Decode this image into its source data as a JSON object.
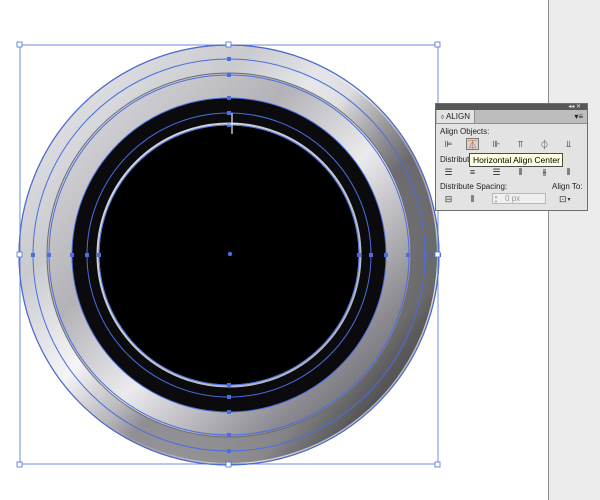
{
  "align_panel": {
    "tab_label": "ALIGN",
    "tab_caret": "◊",
    "collapse_glyph": "◂◂",
    "close_glyph": "✕",
    "menu_glyph": "▾≡",
    "align_objects_label": "Align Objects:",
    "distribute_objects_label": "Distribute",
    "distribute_spacing_label": "Distribute Spacing:",
    "align_to_label": "Align To:",
    "spacing_value": "0 px",
    "spin_up": "▲",
    "spin_down": "▼",
    "tooltip": "Horizontal Align Center",
    "align_object_buttons": [
      {
        "icon": "horizontal-align-left-icon",
        "glyph": "⊫",
        "pressed": false
      },
      {
        "icon": "horizontal-align-center-icon",
        "glyph": "⏄",
        "pressed": true
      },
      {
        "icon": "horizontal-align-right-icon",
        "glyph": "⊪",
        "pressed": false
      },
      {
        "icon": "vertical-align-top-icon",
        "glyph": "⫪",
        "pressed": false
      },
      {
        "icon": "vertical-align-center-icon",
        "glyph": "⏀",
        "pressed": false
      },
      {
        "icon": "vertical-align-bottom-icon",
        "glyph": "⫫",
        "pressed": false
      }
    ],
    "distribute_object_buttons": [
      {
        "icon": "vertical-distribute-top-icon",
        "glyph": "☰"
      },
      {
        "icon": "vertical-distribute-center-icon",
        "glyph": "≡"
      },
      {
        "icon": "vertical-distribute-bottom-icon",
        "glyph": "☰"
      },
      {
        "icon": "horizontal-distribute-left-icon",
        "glyph": "⫴"
      },
      {
        "icon": "horizontal-distribute-center-icon",
        "glyph": "⫵"
      },
      {
        "icon": "horizontal-distribute-right-icon",
        "glyph": "⫴"
      }
    ],
    "distribute_spacing_buttons": [
      {
        "icon": "vertical-distribute-space-icon",
        "glyph": "⊟"
      },
      {
        "icon": "horizontal-distribute-space-icon",
        "glyph": "⫴"
      }
    ],
    "align_to_icon": "align-to-selection-icon",
    "align_to_glyph": "⊡",
    "align_to_caret": "▾"
  },
  "colors": {
    "selection": "#4a6ee0",
    "panel_bg": "#e3e3e3",
    "tooltip_bg": "#ffffe1",
    "canvas_bg": "#ffffff",
    "gutter_bg": "#ececec"
  }
}
